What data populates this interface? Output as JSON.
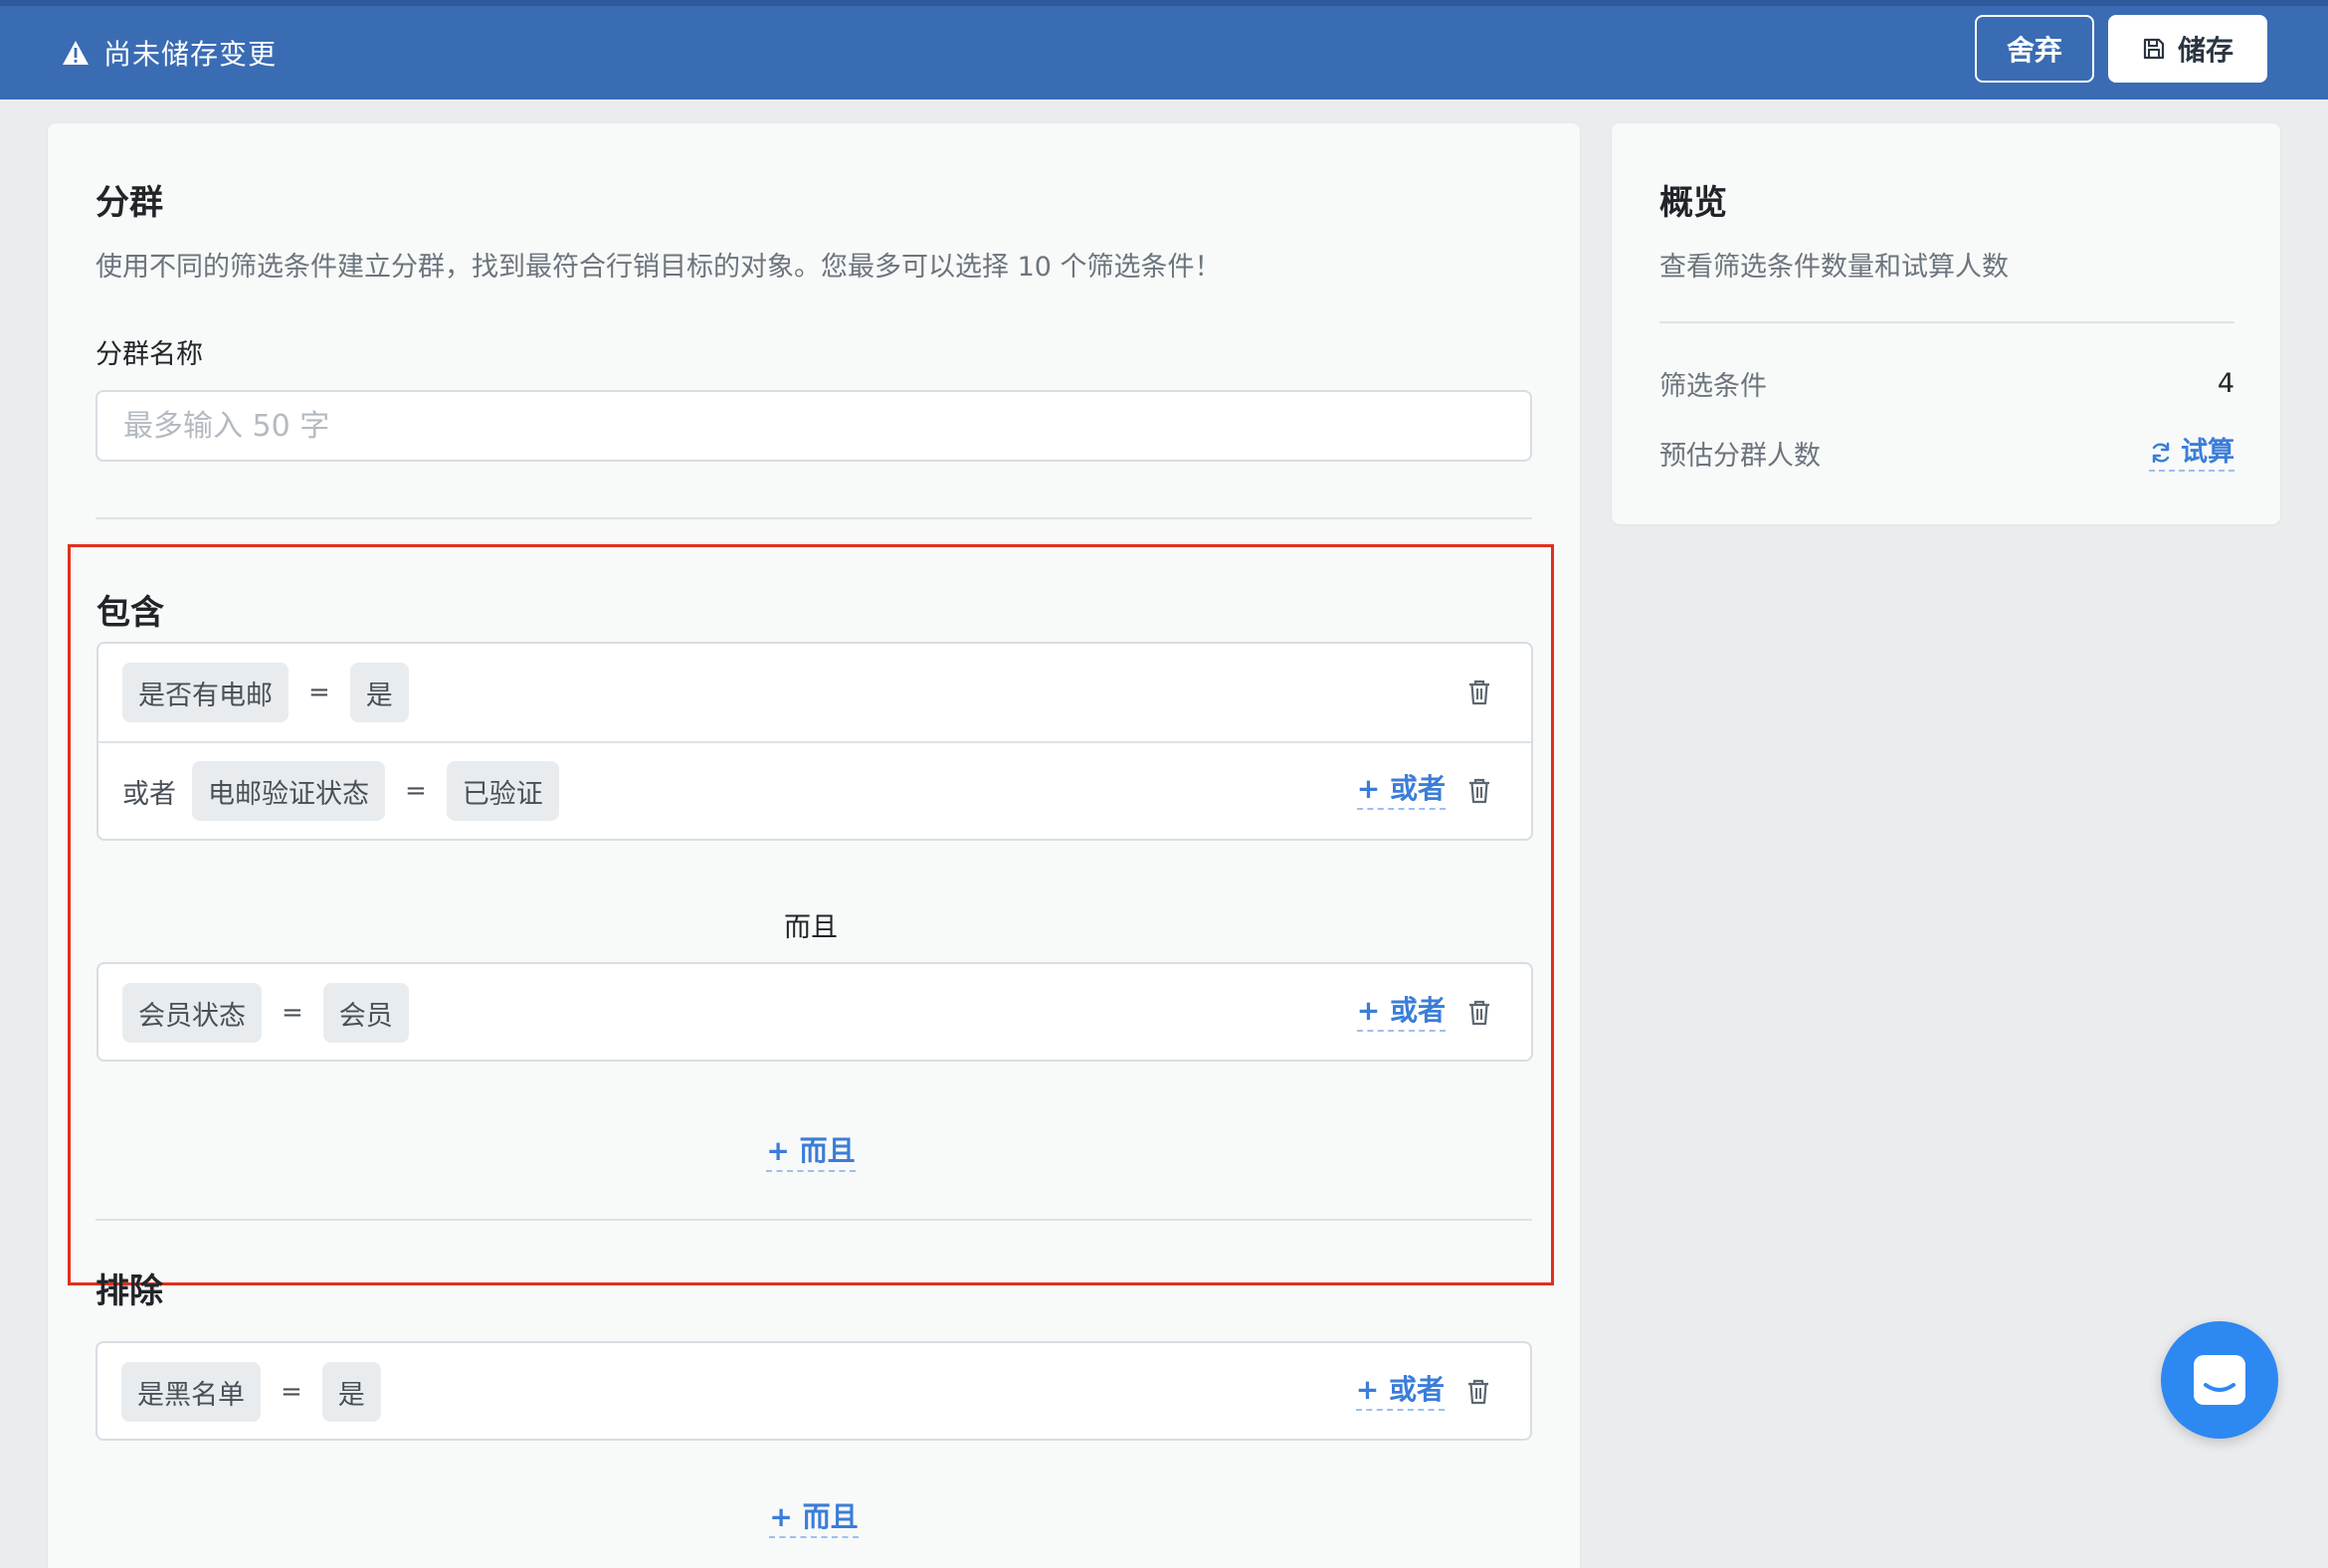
{
  "topbar": {
    "warning_text": "尚未储存变更",
    "warning_icon": "warning-icon",
    "discard_label": "舍弃",
    "save_label": "储存",
    "save_icon": "floppy-disk-icon",
    "background_color": "#3a6cb4"
  },
  "segment": {
    "title": "分群",
    "description": "使用不同的筛选条件建立分群，找到最符合行销目标的对象。您最多可以选择 10 个筛选条件！",
    "name_label": "分群名称",
    "name_value": "",
    "name_placeholder": "最多输入 50 字"
  },
  "include": {
    "title": "包含",
    "groups": [
      {
        "rows": [
          {
            "prefix": "",
            "field": "是否有电邮",
            "operator": "=",
            "value": "是",
            "show_or_link": false
          },
          {
            "prefix": "或者",
            "field": "电邮验证状态",
            "operator": "=",
            "value": "已验证",
            "show_or_link": true
          }
        ]
      },
      {
        "rows": [
          {
            "prefix": "",
            "field": "会员状态",
            "operator": "=",
            "value": "会员",
            "show_or_link": true
          }
        ]
      }
    ],
    "and_separator": "而且",
    "or_link": "+ 或者",
    "add_and_link": "+ 而且",
    "highlight_color": "#e0301e"
  },
  "exclude": {
    "title": "排除",
    "rows": [
      {
        "field": "是黑名单",
        "operator": "=",
        "value": "是"
      }
    ],
    "or_link": "+ 或者",
    "add_and_link": "+ 而且"
  },
  "overview": {
    "title": "概览",
    "description": "查看筛选条件数量和试算人数",
    "filter_count_label": "筛选条件",
    "filter_count_value": "4",
    "estimate_label": "预估分群人数",
    "estimate_link": "试算",
    "estimate_icon": "refresh-icon"
  },
  "chat": {
    "icon": "chat-icon",
    "color": "#2e88f1"
  },
  "colors": {
    "accent": "#3b7dd8",
    "page_bg": "#ebecee",
    "card_bg": "#f8f9f9"
  }
}
